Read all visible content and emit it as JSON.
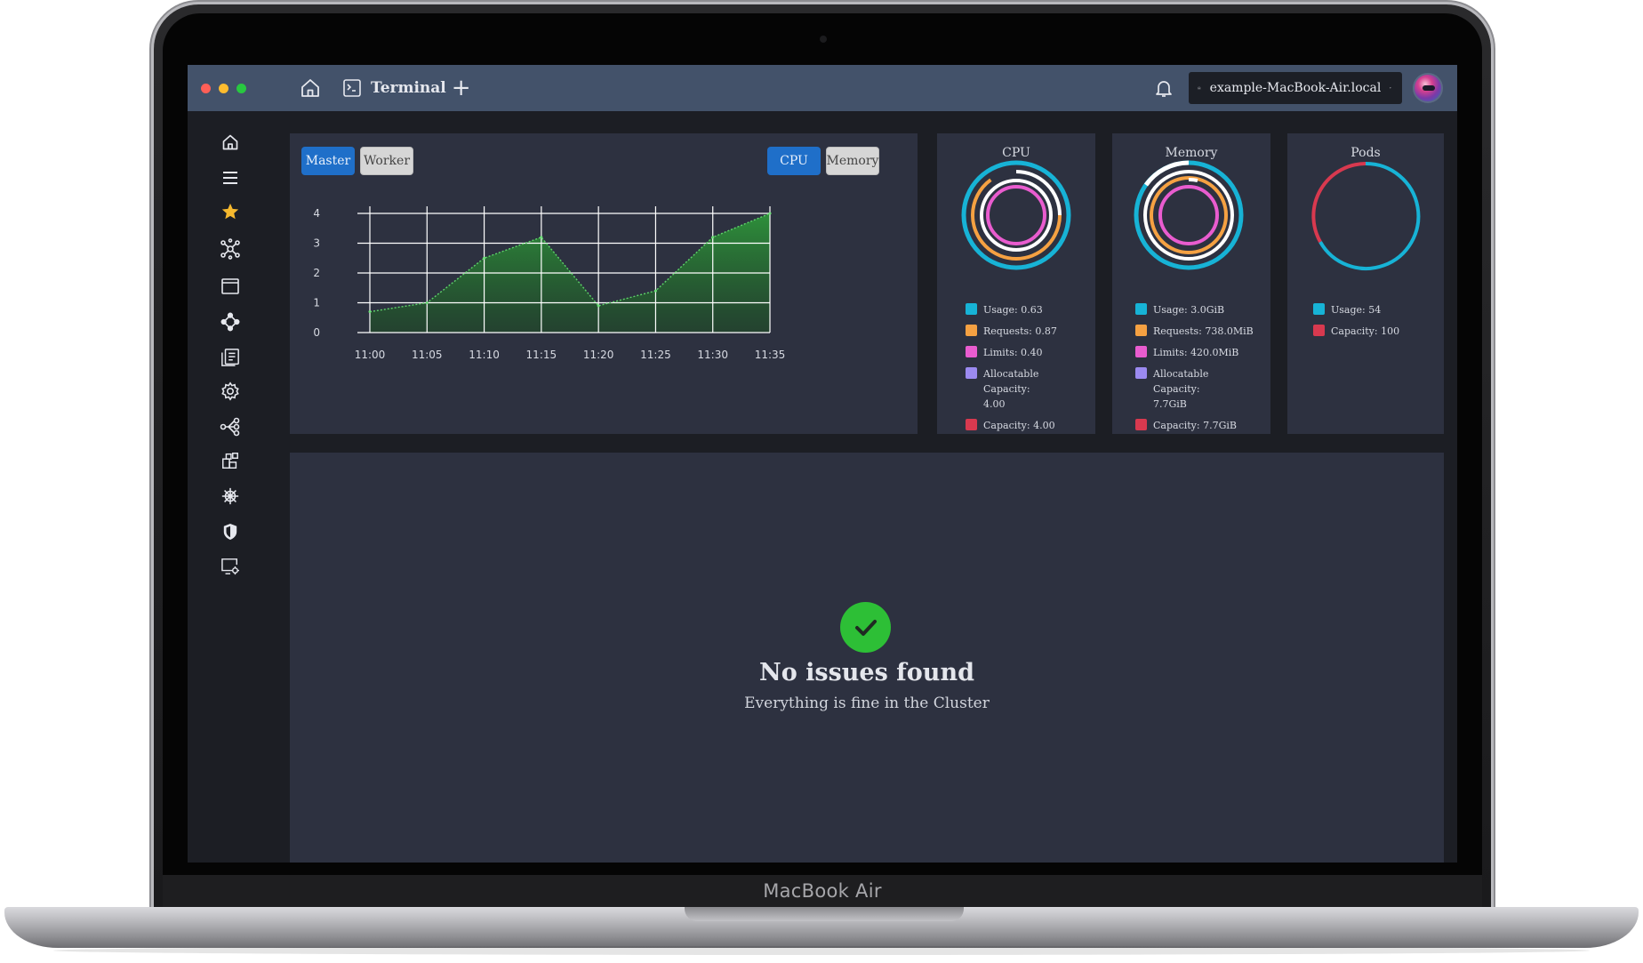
{
  "device": {
    "label": "MacBook Air"
  },
  "window": {
    "traffic_lights": {
      "close": "#ff5f57",
      "minimize": "#febc2e",
      "maximize": "#28c840"
    }
  },
  "topbar": {
    "home_icon": "home-icon",
    "tab_label": "Terminal",
    "add_tab": "+",
    "bell_icon": "bell-icon",
    "context": "example-MacBook-Air.local"
  },
  "sidebar": {
    "items": [
      {
        "icon": "home-icon"
      },
      {
        "icon": "menu-icon"
      },
      {
        "icon": "star-icon",
        "active_color": "#f5b82e"
      },
      {
        "icon": "cluster-nodes-icon"
      },
      {
        "icon": "window-icon"
      },
      {
        "icon": "network-icon"
      },
      {
        "icon": "docs-icon"
      },
      {
        "icon": "settings-gear-icon"
      },
      {
        "icon": "topology-icon"
      },
      {
        "icon": "apps-icon"
      },
      {
        "icon": "helm-icon"
      },
      {
        "icon": "shield-icon"
      },
      {
        "icon": "screen-settings-icon"
      }
    ]
  },
  "chart_panel": {
    "node_buttons": {
      "master": "Master",
      "worker": "Worker"
    },
    "metric_buttons": {
      "cpu": "CPU",
      "memory": "Memory"
    }
  },
  "chart_data": {
    "type": "area",
    "categories": [
      "11:00",
      "11:05",
      "11:10",
      "11:15",
      "11:20",
      "11:25",
      "11:30",
      "11:35"
    ],
    "values": [
      0.7,
      1.0,
      2.5,
      3.2,
      0.9,
      1.4,
      3.2,
      4.0
    ],
    "yticks": [
      "0",
      "1",
      "2",
      "3",
      "4"
    ],
    "ylim": [
      0,
      4
    ],
    "grid": true,
    "color": "#2e9a3a"
  },
  "cpu": {
    "title": "CPU",
    "legend": [
      {
        "label": "Usage: 0.63",
        "color": "#17b3d6"
      },
      {
        "label": "Requests: 0.87",
        "color": "#f5a142"
      },
      {
        "label": "Limits: 0.40",
        "color": "#e95ccf"
      },
      {
        "label": "Allocatable Capacity: 4.00",
        "color": "#9b8af0"
      },
      {
        "label": "Capacity: 4.00",
        "color": "#d8394f"
      }
    ]
  },
  "memory": {
    "title": "Memory",
    "legend": [
      {
        "label": "Usage: 3.0GiB",
        "color": "#17b3d6"
      },
      {
        "label": "Requests: 738.0MiB",
        "color": "#f5a142"
      },
      {
        "label": "Limits: 420.0MiB",
        "color": "#e95ccf"
      },
      {
        "label": "Allocatable Capacity: 7.7GiB",
        "color": "#9b8af0"
      },
      {
        "label": "Capacity: 7.7GiB",
        "color": "#d8394f"
      }
    ]
  },
  "pods": {
    "title": "Pods",
    "legend": [
      {
        "label": "Usage: 54",
        "color": "#17b3d6"
      },
      {
        "label": "Capacity: 100",
        "color": "#d8394f"
      }
    ]
  },
  "issues": {
    "title": "No issues found",
    "subtitle": "Everything is fine in the Cluster",
    "status_color": "#2dbf36"
  }
}
